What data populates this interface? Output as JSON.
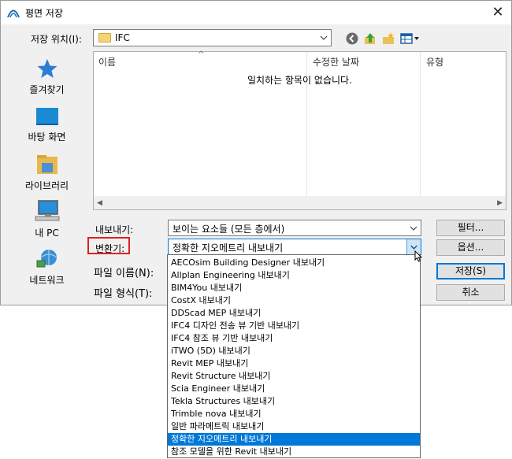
{
  "window": {
    "title": "평면 저장",
    "close_glyph": "✕"
  },
  "location": {
    "label": "저장 위치(I):",
    "value": "IFC"
  },
  "toolbar": {
    "icons": [
      "back-icon",
      "up-folder-icon",
      "new-folder-icon",
      "view-menu-icon"
    ]
  },
  "places": [
    {
      "label": "즐겨찾기",
      "icon": "star-icon"
    },
    {
      "label": "바탕 화면",
      "icon": "desktop-icon"
    },
    {
      "label": "라이브러리",
      "icon": "library-icon"
    },
    {
      "label": "내 PC",
      "icon": "computer-icon"
    },
    {
      "label": "네트워크",
      "icon": "network-icon"
    }
  ],
  "filelist": {
    "columns": [
      "이름",
      "수정한 날짜",
      "유형"
    ],
    "empty_message": "일치하는 항목이 없습니다."
  },
  "form": {
    "export_label": "내보내기:",
    "export_value": "보이는 요소들 (모든 층에서)",
    "translator_label": "변환기:",
    "translator_value": "정확한 지오메트리 내보내기",
    "filename_label": "파일 이름(N):",
    "filetype_label": "파일 형식(T):"
  },
  "buttons": {
    "filter": "필터...",
    "options": "옵션...",
    "save": "저장(S)",
    "cancel": "취소"
  },
  "dropdown": {
    "items": [
      "AECOsim Building Designer 내보내기",
      "Allplan Engineering 내보내기",
      "BIM4You 내보내기",
      "CostX 내보내기",
      "DDScad MEP 내보내기",
      "IFC4 디자인 전송 뷰 기반 내보내기",
      "IFC4 참조 뷰 기반 내보내기",
      "iTWO (5D) 내보내기",
      "Revit MEP 내보내기",
      "Revit Structure 내보내기",
      "Scia Engineer 내보내기",
      "Tekla Structures 내보내기",
      "Trimble nova 내보내기",
      "일반 파라메트릭 내보내기",
      "정확한 지오메트리 내보내기",
      "참조 모델을 위한 Revit 내보내기"
    ],
    "selected_index": 14
  },
  "colors": {
    "accent": "#0078d7",
    "highlight_box": "#e02020"
  }
}
